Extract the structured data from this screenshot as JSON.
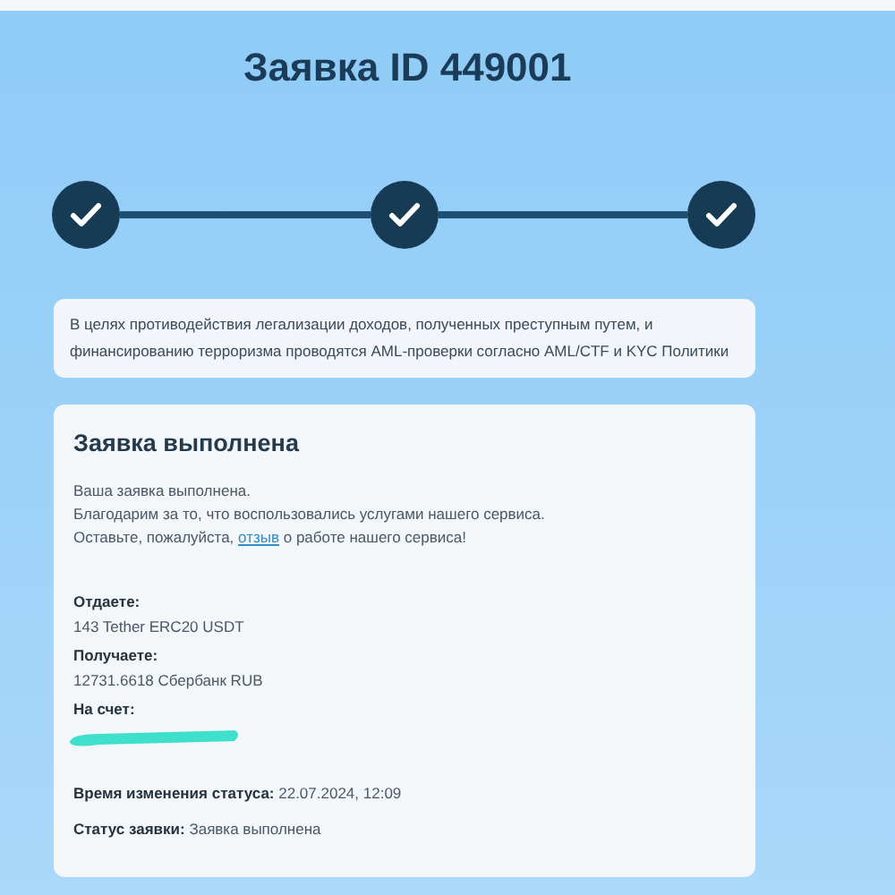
{
  "title": "Заявка ID 449001",
  "steps": [
    {
      "done": true
    },
    {
      "done": true
    },
    {
      "done": true
    }
  ],
  "notice": "В целях противодействия легализации доходов, полученных преступным путем, и финансированию терроризма проводятся AML-проверки согласно AML/CTF и KYC Политики",
  "card": {
    "heading": "Заявка выполнена",
    "intro_lines": [
      "Ваша заявка выполнена.",
      "Благодарим за то, что воспользовались услугами нашего сервиса."
    ],
    "review": {
      "before": "Оставьте, пожалуйста, ",
      "link": "отзыв",
      "after": " о работе нашего сервиса!"
    },
    "fields": [
      {
        "label": "Отдаете:",
        "value": "143 Tether ERC20 USDT"
      },
      {
        "label": "Получаете:",
        "value": "12731.6618 Сбербанк RUB"
      },
      {
        "label": "На счет:",
        "redacted": true
      }
    ],
    "status_lines": [
      {
        "label": "Время изменения статуса:",
        "value": "22.07.2024, 12:09"
      },
      {
        "label": "Статус заявки:",
        "value": "Заявка выполнена"
      }
    ]
  }
}
